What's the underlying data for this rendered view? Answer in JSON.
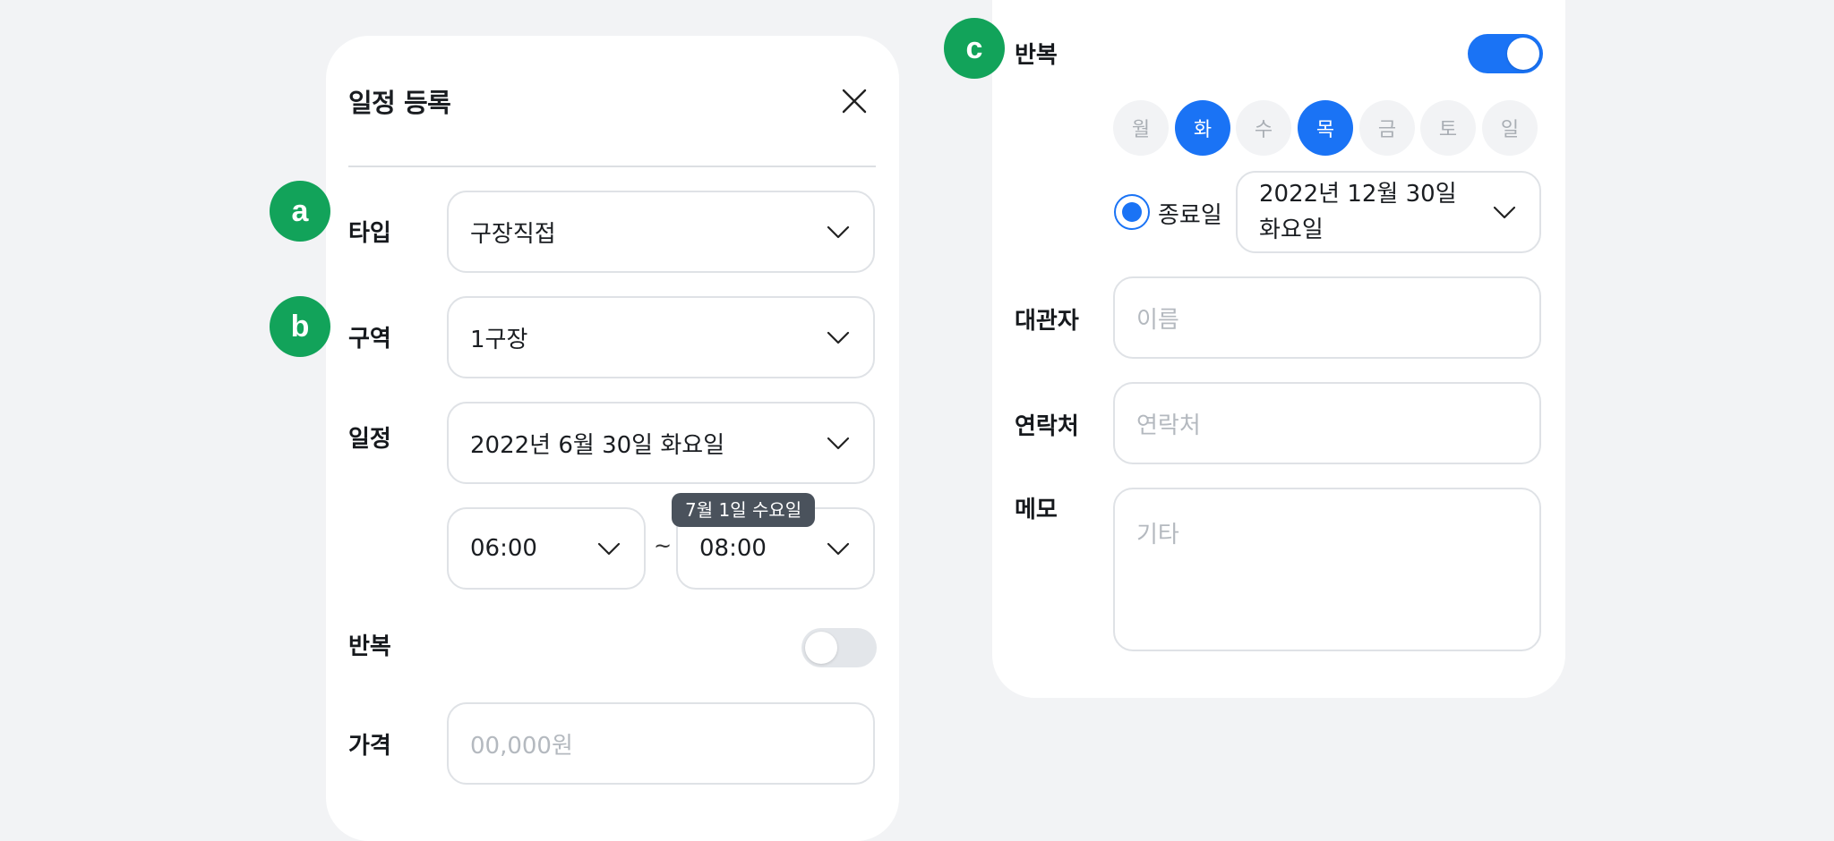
{
  "form": {
    "title": "일정 등록",
    "type": {
      "label": "타입",
      "value": "구장직접"
    },
    "area": {
      "label": "구역",
      "value": "1구장"
    },
    "schedule": {
      "label": "일정",
      "date": "2022년 6월 30일 화요일",
      "start_time": "06:00",
      "separator": "~",
      "end_time": "08:00",
      "end_tooltip": "7월 1일 수요일"
    },
    "repeat": {
      "label": "반복",
      "enabled": false
    },
    "price": {
      "label": "가격",
      "placeholder": "00,000원"
    }
  },
  "repeat_panel": {
    "label": "반복",
    "enabled": true,
    "days": [
      {
        "label": "월",
        "selected": false
      },
      {
        "label": "화",
        "selected": true
      },
      {
        "label": "수",
        "selected": false
      },
      {
        "label": "목",
        "selected": true
      },
      {
        "label": "금",
        "selected": false
      },
      {
        "label": "토",
        "selected": false
      },
      {
        "label": "일",
        "selected": false
      }
    ],
    "end_date": {
      "label": "종료일",
      "selected": true,
      "line1": "2022년 12월 30일",
      "line2": "화요일"
    },
    "renter": {
      "label": "대관자",
      "placeholder": "이름"
    },
    "contact": {
      "label": "연락처",
      "placeholder": "연락처"
    },
    "memo": {
      "label": "메모",
      "placeholder": "기타"
    }
  },
  "badges": {
    "a": "a",
    "b": "b",
    "c": "c"
  },
  "colors": {
    "accent": "#1a73f5",
    "badge": "#12a35a",
    "tooltip": "#4a525c"
  },
  "icons": {
    "close": "close-icon",
    "dropdown": "chevron-down-icon"
  }
}
